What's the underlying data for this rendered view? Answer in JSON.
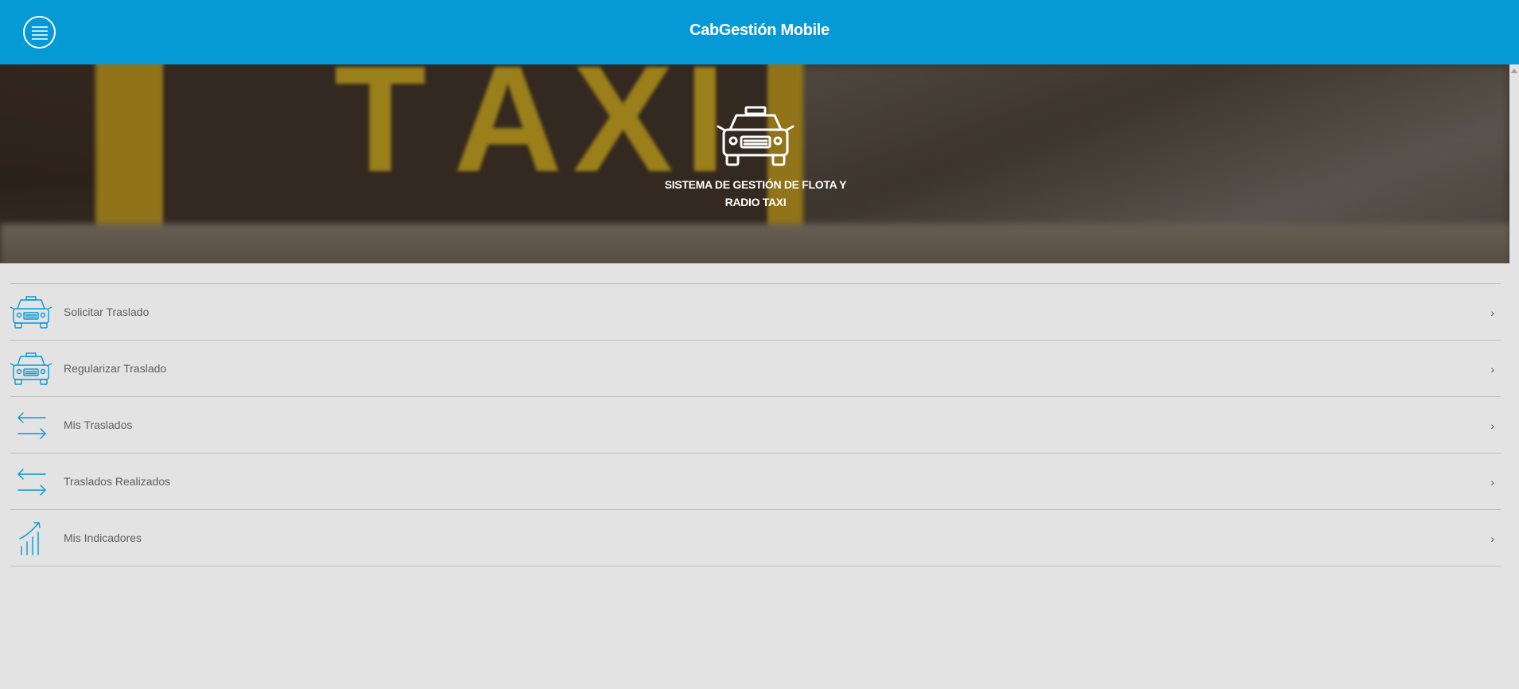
{
  "header": {
    "title": "CabGestión Mobile",
    "menu_icon": "hamburger-menu-icon"
  },
  "hero": {
    "logo_icon": "taxi-icon",
    "line1": "SISTEMA DE GESTIÓN DE FLOTA Y",
    "line2": "RADIO TAXI",
    "background_letters": [
      "T",
      "A",
      "X",
      "I"
    ]
  },
  "menu": {
    "chevron": "›",
    "items": [
      {
        "label": "Solicitar Traslado",
        "icon": "taxi-icon"
      },
      {
        "label": "Regularizar Traslado",
        "icon": "taxi-icon"
      },
      {
        "label": "Mis Traslados",
        "icon": "transfer-arrows-icon"
      },
      {
        "label": "Traslados Realizados",
        "icon": "transfer-arrows-icon"
      },
      {
        "label": "Mis Indicadores",
        "icon": "bar-chart-trend-icon"
      }
    ]
  },
  "colors": {
    "accent": "#0599d6",
    "background": "#e3e3e3",
    "label_text": "#5f5f5f"
  }
}
